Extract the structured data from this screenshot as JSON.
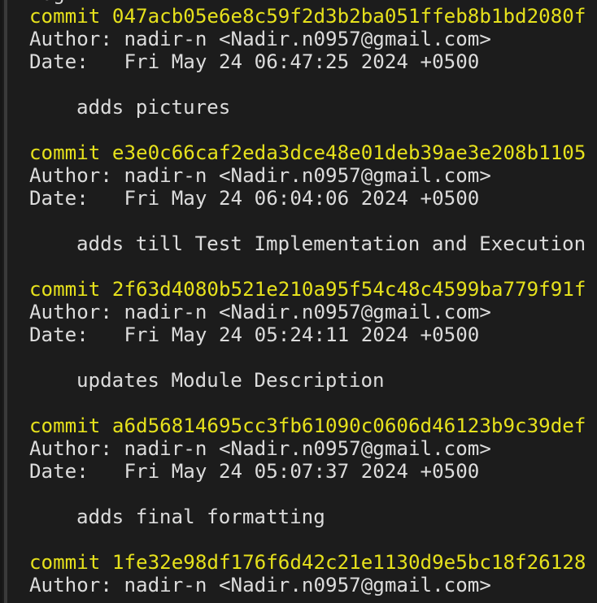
{
  "terminal": {
    "top_partial": "log",
    "commits": [
      {
        "commit": "commit 047acb05e6e8c59f2d3b2ba051ffeb8b1bd2080f",
        "author": "Author: nadir-n <Nadir.n0957@gmail.com>",
        "date": "Date:   Fri May 24 06:47:25 2024 +0500",
        "message": "adds pictures"
      },
      {
        "commit": "commit e3e0c66caf2eda3dce48e01deb39ae3e208b1105",
        "author": "Author: nadir-n <Nadir.n0957@gmail.com>",
        "date": "Date:   Fri May 24 06:04:06 2024 +0500",
        "message": "adds till Test Implementation and Execution"
      },
      {
        "commit": "commit 2f63d4080b521e210a95f54c48c4599ba779f91f",
        "author": "Author: nadir-n <Nadir.n0957@gmail.com>",
        "date": "Date:   Fri May 24 05:24:11 2024 +0500",
        "message": "updates Module Description"
      },
      {
        "commit": "commit a6d56814695cc3fb61090c0606d46123b9c39def",
        "author": "Author: nadir-n <Nadir.n0957@gmail.com>",
        "date": "Date:   Fri May 24 05:07:37 2024 +0500",
        "message": "adds final formatting"
      },
      {
        "commit": "commit 1fe32e98df176f6d42c21e1130d9e5bc18f26128",
        "author": "Author: nadir-n <Nadir.n0957@gmail.com>"
      }
    ]
  },
  "colors": {
    "background": "#1c1c1c",
    "commit_hash": "#e6e11c",
    "text": "#dcdcdc"
  }
}
